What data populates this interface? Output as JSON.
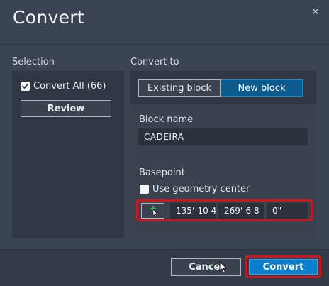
{
  "dialog": {
    "title": "Convert",
    "close_glyph": "✕"
  },
  "selection": {
    "label": "Selection",
    "convert_all_label": "Convert All (66)",
    "convert_all_checked": true,
    "review_label": "Review"
  },
  "convert_to": {
    "label": "Convert to",
    "existing_block_label": "Existing block",
    "new_block_label": "New block",
    "selected": "New block",
    "block_name_label": "Block name",
    "block_name_value": "CADEIRA",
    "basepoint_label": "Basepoint",
    "use_geometry_center_label": "Use geometry center",
    "use_geometry_center_checked": false,
    "coords": {
      "x": "135'-10 4",
      "y": "269'-6 8",
      "z": "0\""
    }
  },
  "footer": {
    "cancel_label": "Cancel",
    "convert_label": "Convert"
  },
  "colors": {
    "accent": "#0a7fcd",
    "highlight": "#d0141b",
    "pick_point": "#3ec95a"
  },
  "icons": {
    "close": "close-icon",
    "checkmark": "checkmark-icon",
    "pick_point": "pick-point-icon",
    "cursor": "mouse-cursor-icon"
  }
}
